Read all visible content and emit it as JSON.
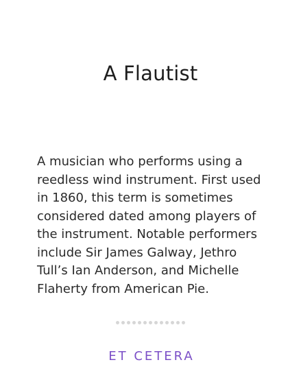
{
  "card": {
    "title": "A Flautist",
    "definition": "A musician who performs using a reedless wind instrument. First used in 1860, this term is sometimes considered dated among players of the instrument. Notable performers include Sir James Galway, Jethro Tull’s Ian Anderson, and Michelle Flaherty from American Pie.",
    "brand": "ET CETERA"
  },
  "divider": {
    "dot_count": 13,
    "dot_color": "#d6d6d6"
  },
  "colors": {
    "brand": "#7b4fc7",
    "text": "#1f1f1f",
    "background": "#ffffff"
  }
}
